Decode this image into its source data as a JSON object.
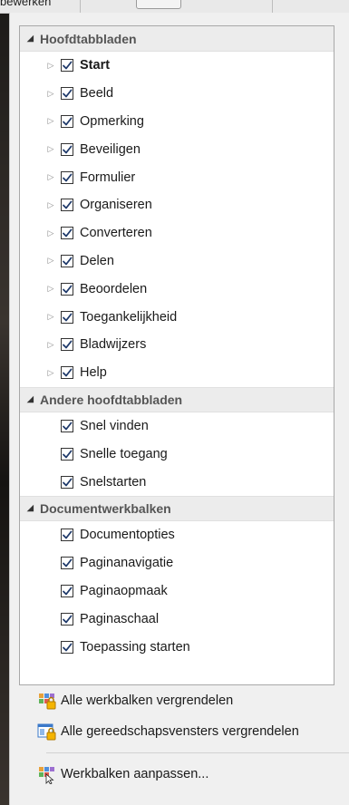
{
  "background": {
    "topbar_fragment": "bewerken"
  },
  "groups": [
    {
      "title": "Hoofdtabbladen",
      "items": [
        {
          "label": "Start",
          "checked": true,
          "bold": true,
          "expandable": true
        },
        {
          "label": "Beeld",
          "checked": true,
          "bold": false,
          "expandable": true
        },
        {
          "label": "Opmerking",
          "checked": true,
          "bold": false,
          "expandable": true
        },
        {
          "label": "Beveiligen",
          "checked": true,
          "bold": false,
          "expandable": true
        },
        {
          "label": "Formulier",
          "checked": true,
          "bold": false,
          "expandable": true
        },
        {
          "label": "Organiseren",
          "checked": true,
          "bold": false,
          "expandable": true
        },
        {
          "label": "Converteren",
          "checked": true,
          "bold": false,
          "expandable": true
        },
        {
          "label": "Delen",
          "checked": true,
          "bold": false,
          "expandable": true
        },
        {
          "label": "Beoordelen",
          "checked": true,
          "bold": false,
          "expandable": true
        },
        {
          "label": "Toegankelijkheid",
          "checked": true,
          "bold": false,
          "expandable": true
        },
        {
          "label": "Bladwijzers",
          "checked": true,
          "bold": false,
          "expandable": true
        },
        {
          "label": "Help",
          "checked": true,
          "bold": false,
          "expandable": true
        }
      ]
    },
    {
      "title": "Andere hoofdtabbladen",
      "items": [
        {
          "label": "Snel vinden",
          "checked": true,
          "bold": false,
          "expandable": false
        },
        {
          "label": "Snelle toegang",
          "checked": true,
          "bold": false,
          "expandable": false
        },
        {
          "label": "Snelstarten",
          "checked": true,
          "bold": false,
          "expandable": false
        }
      ]
    },
    {
      "title": "Documentwerkbalken",
      "items": [
        {
          "label": "Documentopties",
          "checked": true,
          "bold": false,
          "expandable": false
        },
        {
          "label": "Paginanavigatie",
          "checked": true,
          "bold": false,
          "expandable": false
        },
        {
          "label": "Paginaopmaak",
          "checked": true,
          "bold": false,
          "expandable": false
        },
        {
          "label": "Paginaschaal",
          "checked": true,
          "bold": false,
          "expandable": false
        },
        {
          "label": "Toepassing starten",
          "checked": true,
          "bold": false,
          "expandable": false
        }
      ]
    }
  ],
  "actions": {
    "lock_toolbars": "Alle werkbalken vergrendelen",
    "lock_tool_windows": "Alle gereedschapsvensters vergrendelen",
    "customize_toolbars": "Werkbalken aanpassen..."
  },
  "icons": {
    "collapse": "triangle-down-icon",
    "expand": "triangle-right-icon",
    "check": "checkmark-icon",
    "lock_toolbars": "toolbar-lock-icon",
    "lock_windows": "window-lock-icon",
    "customize": "toolbar-customize-icon"
  },
  "colors": {
    "check": "#1f3a6b",
    "header_bg": "#ececec",
    "panel_border": "#a8a8a8",
    "lock": "#f4b400"
  }
}
